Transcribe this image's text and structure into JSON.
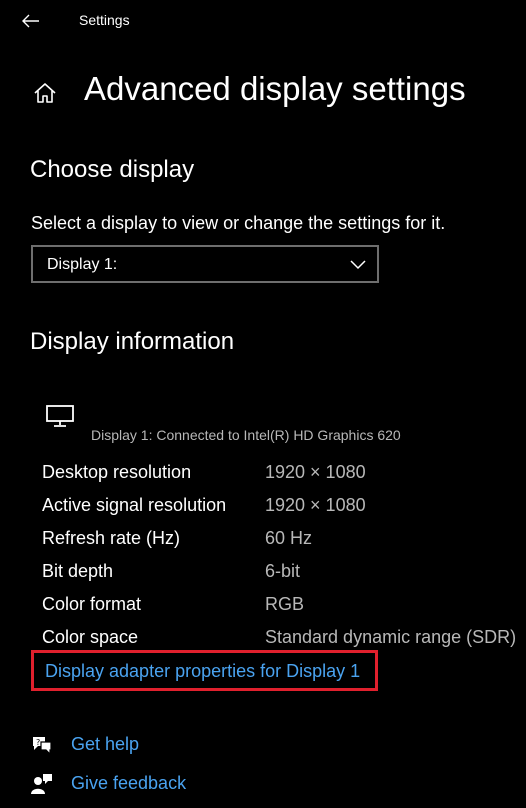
{
  "titlebar": {
    "back_icon": "back-arrow-icon",
    "app_title": "Settings"
  },
  "header": {
    "home_icon": "home-icon",
    "page_title": "Advanced display settings"
  },
  "choose_display": {
    "heading": "Choose display",
    "prompt": "Select a display to view or change the settings for it.",
    "selected": "Display 1:",
    "chevron_icon": "chevron-down-icon"
  },
  "display_info": {
    "heading": "Display information",
    "monitor_icon": "monitor-icon",
    "connected": "Display 1: Connected to Intel(R) HD Graphics 620",
    "rows": [
      {
        "label": "Desktop resolution",
        "value": "1920 × 1080"
      },
      {
        "label": "Active signal resolution",
        "value": "1920 × 1080"
      },
      {
        "label": "Refresh rate (Hz)",
        "value": "60 Hz"
      },
      {
        "label": "Bit depth",
        "value": "6-bit"
      },
      {
        "label": "Color format",
        "value": "RGB"
      },
      {
        "label": "Color space",
        "value": "Standard dynamic range (SDR)"
      }
    ],
    "adapter_link": "Display adapter properties for Display 1"
  },
  "help": {
    "get_help": "Get help",
    "get_help_icon": "help-chat-icon",
    "give_feedback": "Give feedback",
    "give_feedback_icon": "feedback-person-icon"
  },
  "colors": {
    "background": "#000000",
    "link": "#4aa3f0",
    "highlight_border": "#e0202d",
    "secondary_text": "#b8b8b8"
  }
}
